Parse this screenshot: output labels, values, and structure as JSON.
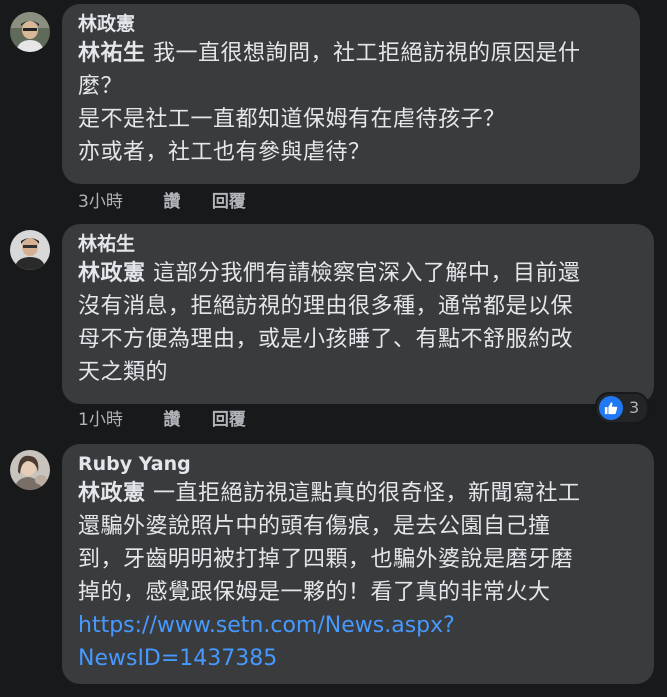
{
  "comments": [
    {
      "author": "林政憲",
      "mention": "林祐生",
      "text_lines": [
        " 我一直很想詢問，社工拒絕訪視的原因是什",
        "麼？",
        "是不是社工一直都知道保姆有在虐待孩子？",
        "亦或者，社工也有參與虐待？"
      ],
      "time": "3小時",
      "like_label": "讚",
      "reply_label": "回覆"
    },
    {
      "author": "林祐生",
      "mention": "林政憲",
      "text_lines": [
        " 這部分我們有請檢察官深入了解中，目前還",
        "沒有消息，拒絕訪視的理由很多種，通常都是以保",
        "母不方便為理由，或是小孩睡了、有點不舒服約改",
        "天之類的"
      ],
      "time": "1小時",
      "like_label": "讚",
      "reply_label": "回覆",
      "reaction_count": "3"
    },
    {
      "author": "Ruby Yang",
      "mention": "林政憲",
      "text_lines": [
        " 一直拒絕訪視這點真的很奇怪，新聞寫社工",
        "還騙外婆說照片中的頭有傷痕，是去公園自己撞",
        "到，牙齒明明被打掉了四顆，也騙外婆說是磨牙磨",
        "掉的，感覺跟保姆是一夥的！看了真的非常火大"
      ],
      "link_lines": [
        "https://www.setn.com/News.aspx?",
        "NewsID=1437385"
      ]
    }
  ],
  "colors": {
    "background": "#18191a",
    "bubble": "#3a3b3c",
    "text": "#e4e6eb",
    "muted": "#b0b3b8",
    "link": "#4599ff",
    "like": "#2078f4"
  },
  "icons": {
    "reaction": "thumbs-up-icon"
  }
}
